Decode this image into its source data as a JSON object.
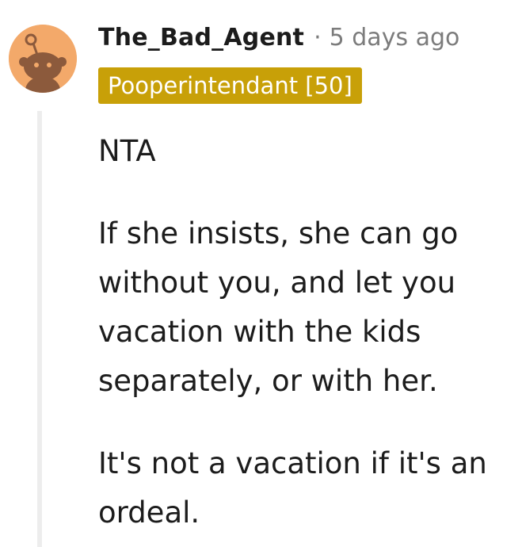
{
  "comment": {
    "username": "The_Bad_Agent",
    "separator": "·",
    "timestamp": "5 days ago",
    "flair": "Pooperintendant [50]",
    "avatar_icon": "reddit-snoo-avatar-icon",
    "paragraphs": [
      "NTA",
      "If she insists, she can go without you, and let you vacation with the kids separately, or with her.",
      "It's not a vacation if it's an ordeal."
    ]
  },
  "colors": {
    "avatar_bg": "#f3a96a",
    "avatar_fg": "#8c5a3c",
    "flair_bg": "#c8a008",
    "flair_text": "#ffffff",
    "meta_text": "#7c7c7c",
    "body_text": "#1c1c1c",
    "thread_line": "#ededed"
  }
}
